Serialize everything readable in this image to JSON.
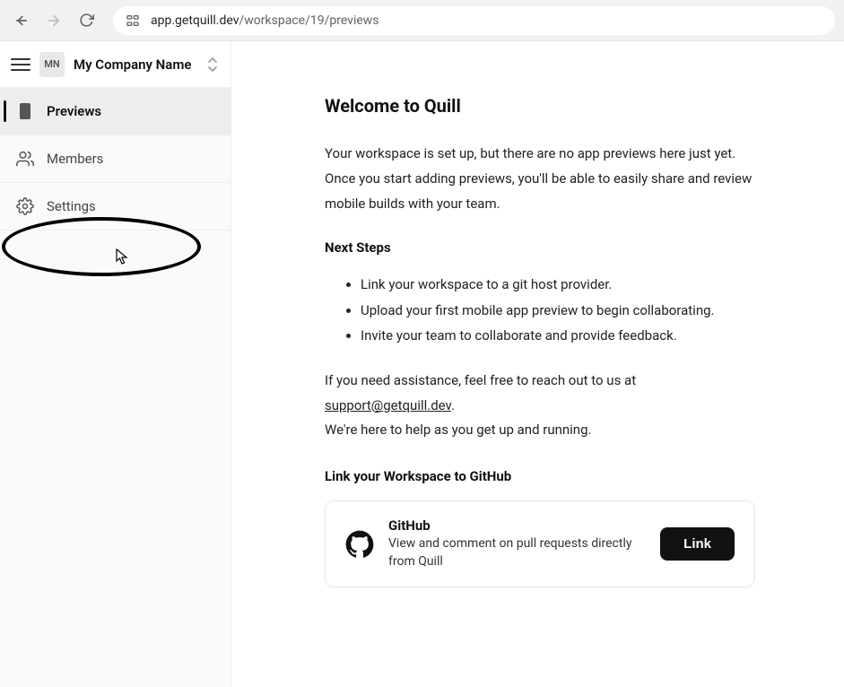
{
  "browser": {
    "url_host": "app.getquill.dev",
    "url_path": "/workspace/19/previews"
  },
  "workspace": {
    "avatar_initials": "MN",
    "name": "My Company Name"
  },
  "sidebar": {
    "items": [
      {
        "label": "Previews",
        "icon": "previews-icon",
        "active": true
      },
      {
        "label": "Members",
        "icon": "members-icon",
        "active": false
      },
      {
        "label": "Settings",
        "icon": "gear-icon",
        "active": false
      }
    ]
  },
  "main": {
    "heading": "Welcome to Quill",
    "intro": "Your workspace is set up, but there are no app previews here just yet. Once you start adding previews, you'll be able to easily share and review mobile builds with your team.",
    "next_steps_heading": "Next Steps",
    "steps": [
      "Link your workspace to a git host provider.",
      "Upload your first mobile app preview to begin collaborating.",
      "Invite your team to collaborate and provide feedback."
    ],
    "assist_prefix": "If you need assistance, feel free to reach out to us at ",
    "support_email": "support@getquill.dev",
    "assist_suffix": ".",
    "assist_line2": "We're here to help as you get up and running.",
    "link_heading": "Link your Workspace to GitHub",
    "github_card": {
      "title": "GitHub",
      "description": "View and comment on pull requests directly from Quill",
      "button_label": "Link"
    }
  }
}
